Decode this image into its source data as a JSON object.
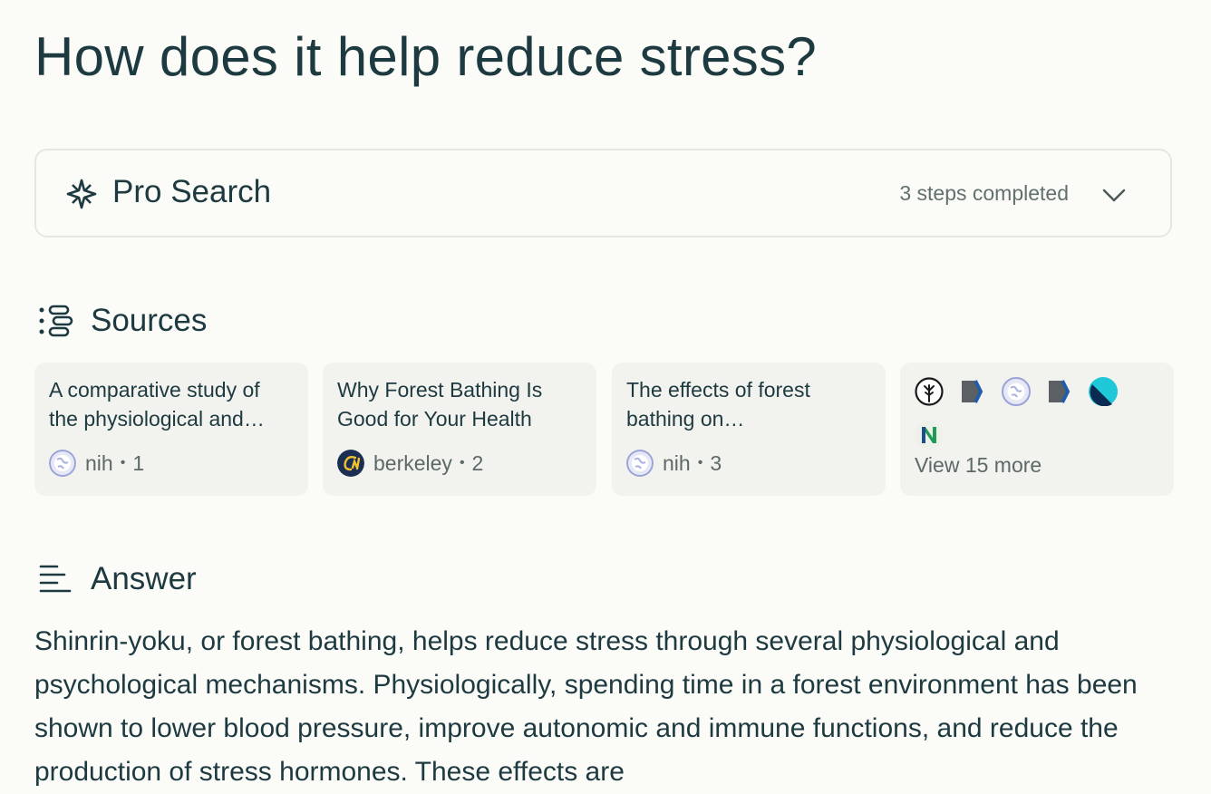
{
  "question": "How does it help reduce stress?",
  "pro_search": {
    "icon": "sparkle-icon",
    "title": "Pro Search",
    "status": "3 steps completed",
    "toggle_icon": "chevron-down-icon"
  },
  "sources": {
    "heading": "Sources",
    "icon": "sources-list-icon",
    "items": [
      {
        "title": "A comparative study of the physiological and…",
        "site": "nih",
        "index": "1",
        "favicon": "globe-icon"
      },
      {
        "title": "Why Forest Bathing Is Good for Your Health",
        "site": "berkeley",
        "index": "2",
        "favicon": "cal-logo-icon"
      },
      {
        "title": "The effects of forest bathing on…",
        "site": "nih",
        "index": "3",
        "favicon": "globe-icon"
      }
    ],
    "more": {
      "label": "View 15 more",
      "favicons": [
        "tree-icon",
        "chevron-logo-icon",
        "globe-icon",
        "chevron-logo-icon",
        "teal-circle-icon",
        "n-logo-icon"
      ]
    }
  },
  "answer": {
    "heading": "Answer",
    "icon": "answer-lines-icon",
    "text": "Shinrin-yoku, or forest bathing, helps reduce stress through several physiological and psychological mechanisms. Physiologically, spending time in a forest environment has been shown to lower blood pressure, improve autonomic and immune functions, and reduce the production of stress hormones. These effects are"
  },
  "colors": {
    "background": "#fbfbf8",
    "text": "#1d3a40",
    "muted": "#5c6968",
    "card": "#f2f2ee",
    "border": "#e7e7e2"
  }
}
